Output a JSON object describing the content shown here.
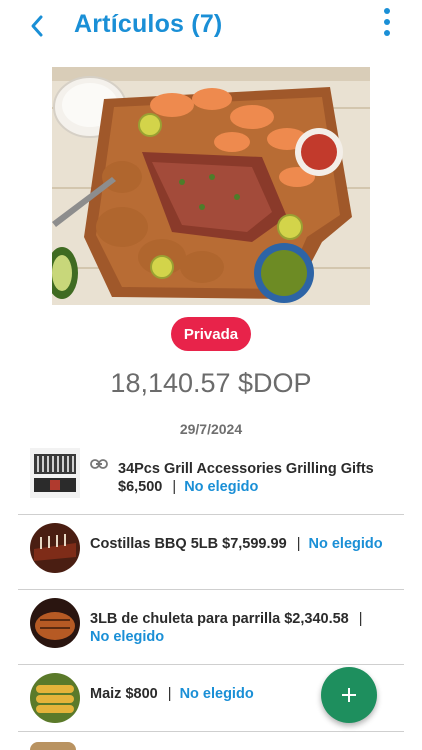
{
  "header": {
    "title": "Artículos (7)",
    "accent_color": "#1a8fd6",
    "back_icon": "chevron-left-icon",
    "menu_icon": "more-vertical-icon"
  },
  "list": {
    "privacy_badge": "Privada",
    "badge_color": "#e8234a",
    "total": "18,140.57 $DOP",
    "date": "29/7/2024"
  },
  "items": [
    {
      "name": "34Pcs Grill Accessories Grilling Gifts",
      "price": "$6,500",
      "separator": "|",
      "status": "No elegido",
      "has_link": true
    },
    {
      "name": "Costillas BBQ 5LB",
      "price": "$7,599.99",
      "separator": "|",
      "status": "No elegido",
      "has_link": false
    },
    {
      "name": "3LB de chuleta para parrilla",
      "price": "$2,340.58",
      "separator": "|",
      "status": "No elegido",
      "has_link": false
    },
    {
      "name": "Maiz",
      "price": "$800",
      "separator": "|",
      "status": "No elegido",
      "has_link": false
    }
  ],
  "fab": {
    "icon": "plus-icon",
    "color": "#1e8f5e"
  }
}
